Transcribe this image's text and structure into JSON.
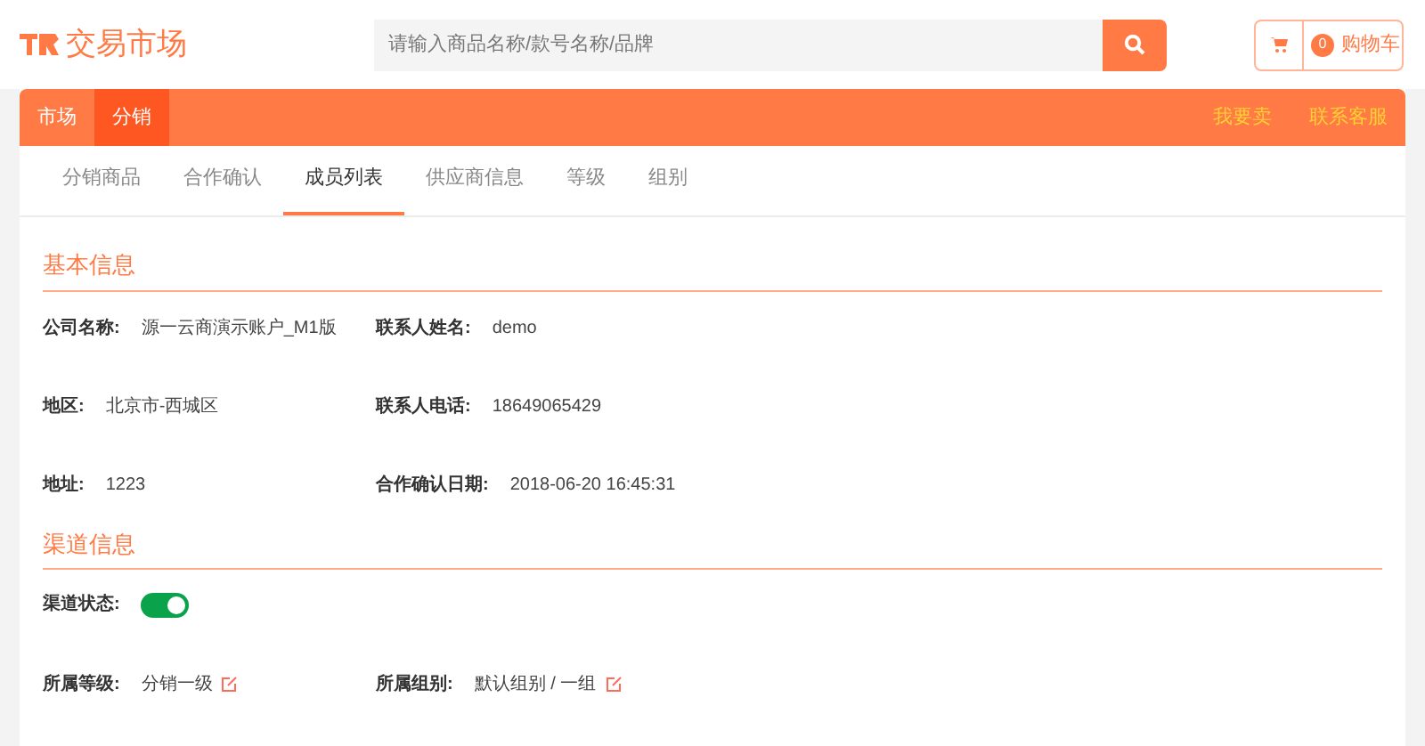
{
  "header": {
    "logo": "交易市场",
    "search": {
      "placeholder": "请输入商品名称/款号名称/品牌"
    },
    "cart": {
      "count": "0",
      "label": "购物车"
    }
  },
  "nav": {
    "items": [
      {
        "label": "市场",
        "selected": false
      },
      {
        "label": "分销",
        "selected": true
      }
    ],
    "links": [
      "我要卖",
      "联系客服"
    ]
  },
  "tabs": [
    {
      "label": "分销商品",
      "selected": false
    },
    {
      "label": "合作确认",
      "selected": false
    },
    {
      "label": "成员列表",
      "selected": true
    },
    {
      "label": "供应商信息",
      "selected": false
    },
    {
      "label": "等级",
      "selected": false
    },
    {
      "label": "组别",
      "selected": false
    }
  ],
  "basic_info": {
    "title": "基本信息",
    "rows": [
      [
        {
          "label": "公司名称:",
          "value": "源一云商演示账户_M1版"
        },
        {
          "label": "联系人姓名:",
          "value": "demo"
        }
      ],
      [
        {
          "label": "地区:",
          "value": "北京市-西城区"
        },
        {
          "label": "联系人电话:",
          "value": "18649065429"
        }
      ],
      [
        {
          "label": "地址:",
          "value": "1223"
        },
        {
          "label": "合作确认日期:",
          "value": "2018-06-20 16:45:31"
        }
      ]
    ]
  },
  "channel_info": {
    "title": "渠道信息",
    "status": {
      "label": "渠道状态:",
      "on": true
    },
    "fields": [
      {
        "label": "所属等级:",
        "value": "分销一级"
      },
      {
        "label": "所属组别:",
        "value": "默认组别 / 一组"
      }
    ]
  }
}
